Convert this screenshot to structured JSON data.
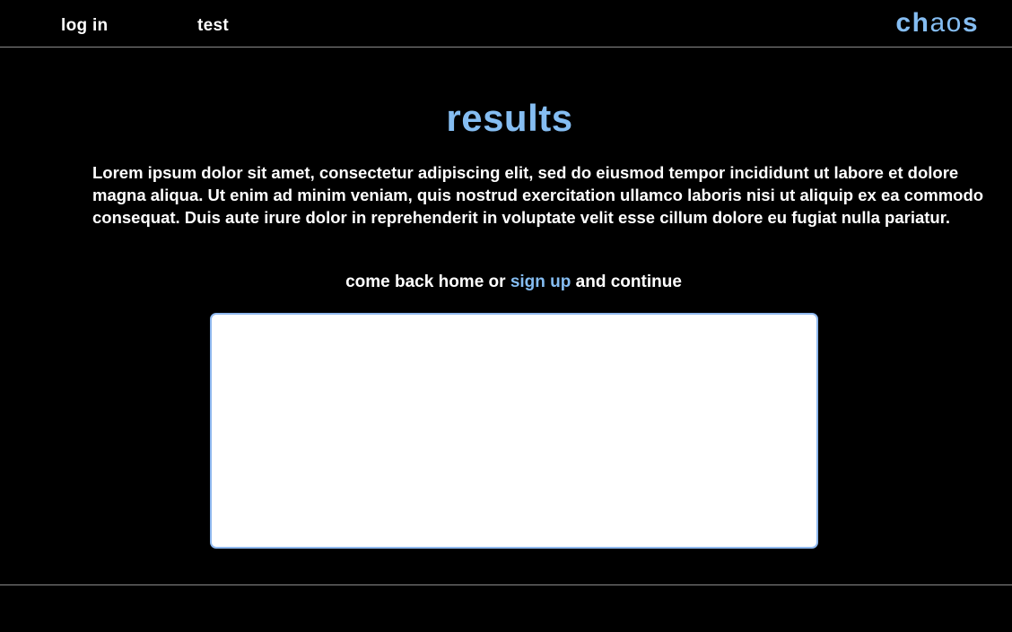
{
  "nav": {
    "login_label": "log in",
    "test_label": "test"
  },
  "logo": {
    "part1": "ch",
    "part2": "ao",
    "part3": "s"
  },
  "main": {
    "title": "results",
    "body": "Lorem ipsum dolor sit amet, consectetur adipiscing elit, sed do eiusmod tempor incididunt ut labore et dolore magna aliqua. Ut enim ad minim veniam, quis nostrud exercitation ullamco laboris nisi ut aliquip ex ea commodo consequat. Duis aute irure dolor in reprehenderit in voluptate velit esse cillum dolore eu fugiat nulla pariatur.",
    "cta_prefix": "come back home or ",
    "cta_link": "sign up",
    "cta_suffix": " and continue"
  },
  "colors": {
    "background": "#000000",
    "accent": "#85bdf2",
    "text": "#ffffff",
    "divider": "#8a8a8a"
  }
}
